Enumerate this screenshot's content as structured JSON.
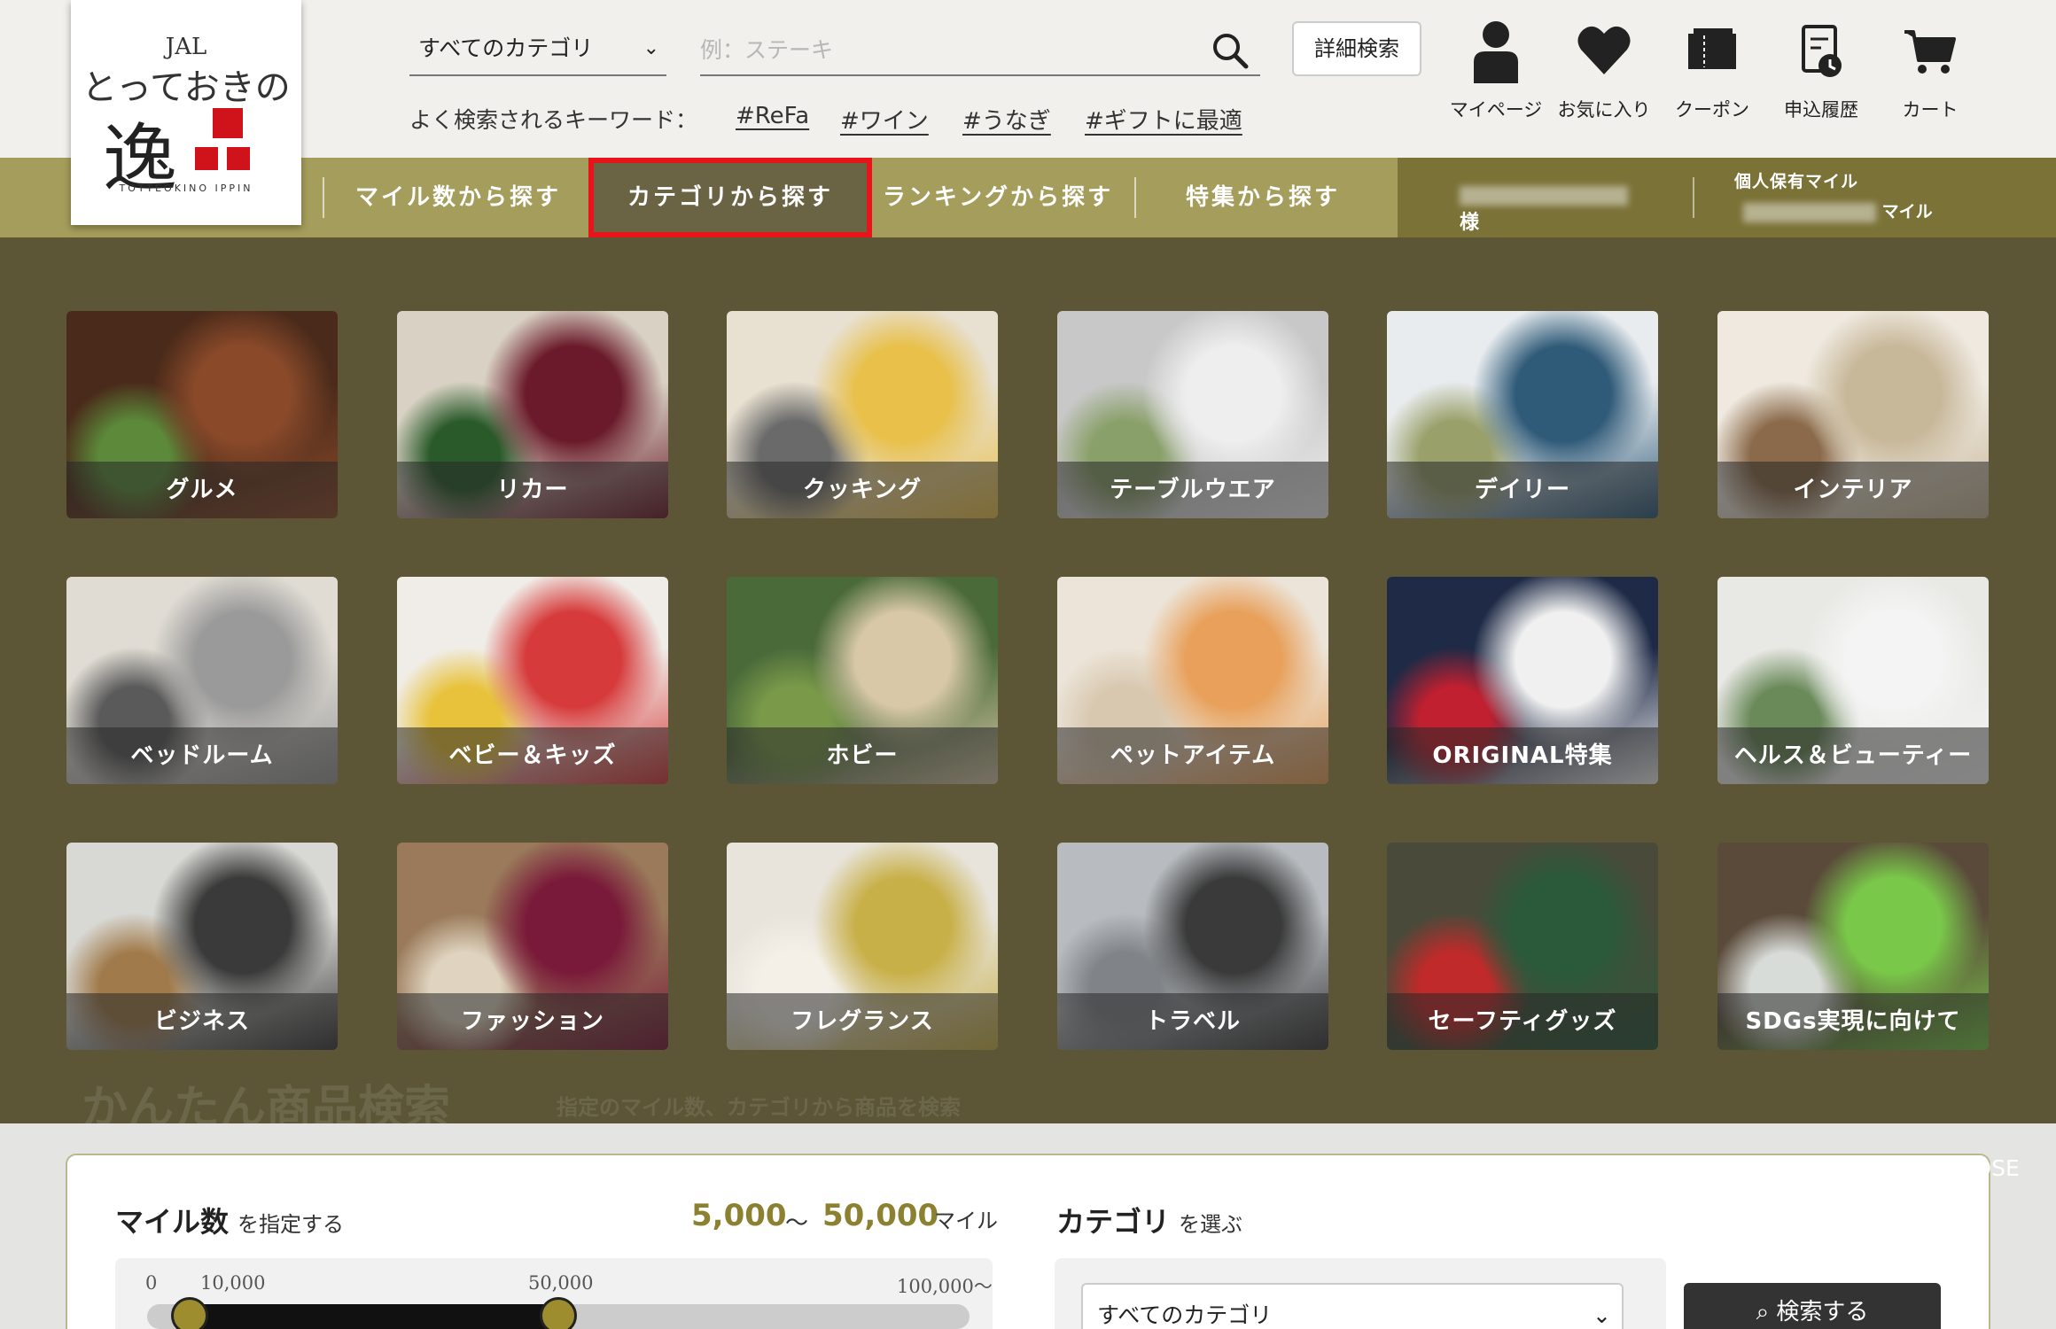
{
  "logo": {
    "top": "JAL",
    "main": "とっておきの",
    "kanji": "逸",
    "sub": "TOTTEOKINO IPPIN"
  },
  "search": {
    "category_selected": "すべてのカテゴリ",
    "placeholder": "例：ステーキ",
    "advanced_label": "詳細検索",
    "keywords_label": "よく検索されるキーワード：",
    "keywords": [
      "#ReFa",
      "#ワイン",
      "#うなぎ",
      "#ギフトに最適"
    ]
  },
  "header_icons": [
    {
      "label": "マイページ",
      "icon": "person-icon"
    },
    {
      "label": "お気に入り",
      "icon": "heart-icon"
    },
    {
      "label": "クーポン",
      "icon": "coupon-icon"
    },
    {
      "label": "申込履歴",
      "icon": "history-icon"
    },
    {
      "label": "カート",
      "icon": "cart-icon"
    }
  ],
  "nav": {
    "items": [
      "マイル数から探す",
      "カテゴリから探す",
      "ランキングから探す",
      "特集から探す"
    ],
    "active_index": 1,
    "user_suffix": "様",
    "miles_label": "個人保有マイル",
    "miles_unit": "マイル"
  },
  "categories": [
    "グルメ",
    "リカー",
    "クッキング",
    "テーブルウエア",
    "デイリー",
    "インテリア",
    "ベッドルーム",
    "ベビー＆キッズ",
    "ホビー",
    "ペットアイテム",
    "ORIGINAL特集",
    "ヘルス＆ビューティー",
    "ビジネス",
    "ファッション",
    "フレグランス",
    "トラベル",
    "セーフティグッズ",
    "SDGs実現に向けて"
  ],
  "background": {
    "heading": "かんたん商品検索",
    "subtext": "指定のマイル数、カテゴリから商品を検索"
  },
  "panel": {
    "close_label": "✕CLOSE",
    "miles_title": "マイル数",
    "miles_sub": "を指定する",
    "min": "5,000",
    "tilde": "～",
    "max": "50,000",
    "unit": "マイル",
    "ticks": [
      "0",
      "10,000",
      "50,000",
      "100,000～"
    ],
    "slider_min_value": 5000,
    "slider_max_value": 50000,
    "slider_max_range": 100000,
    "category_title": "カテゴリ",
    "category_sub": "を選ぶ",
    "category_selected": "すべてのカテゴリ",
    "search_button": "検索する"
  },
  "colors": {
    "accent_red": "#d0131b",
    "nav_gold": "#a59d5b",
    "range_gold": "#8b8130"
  }
}
